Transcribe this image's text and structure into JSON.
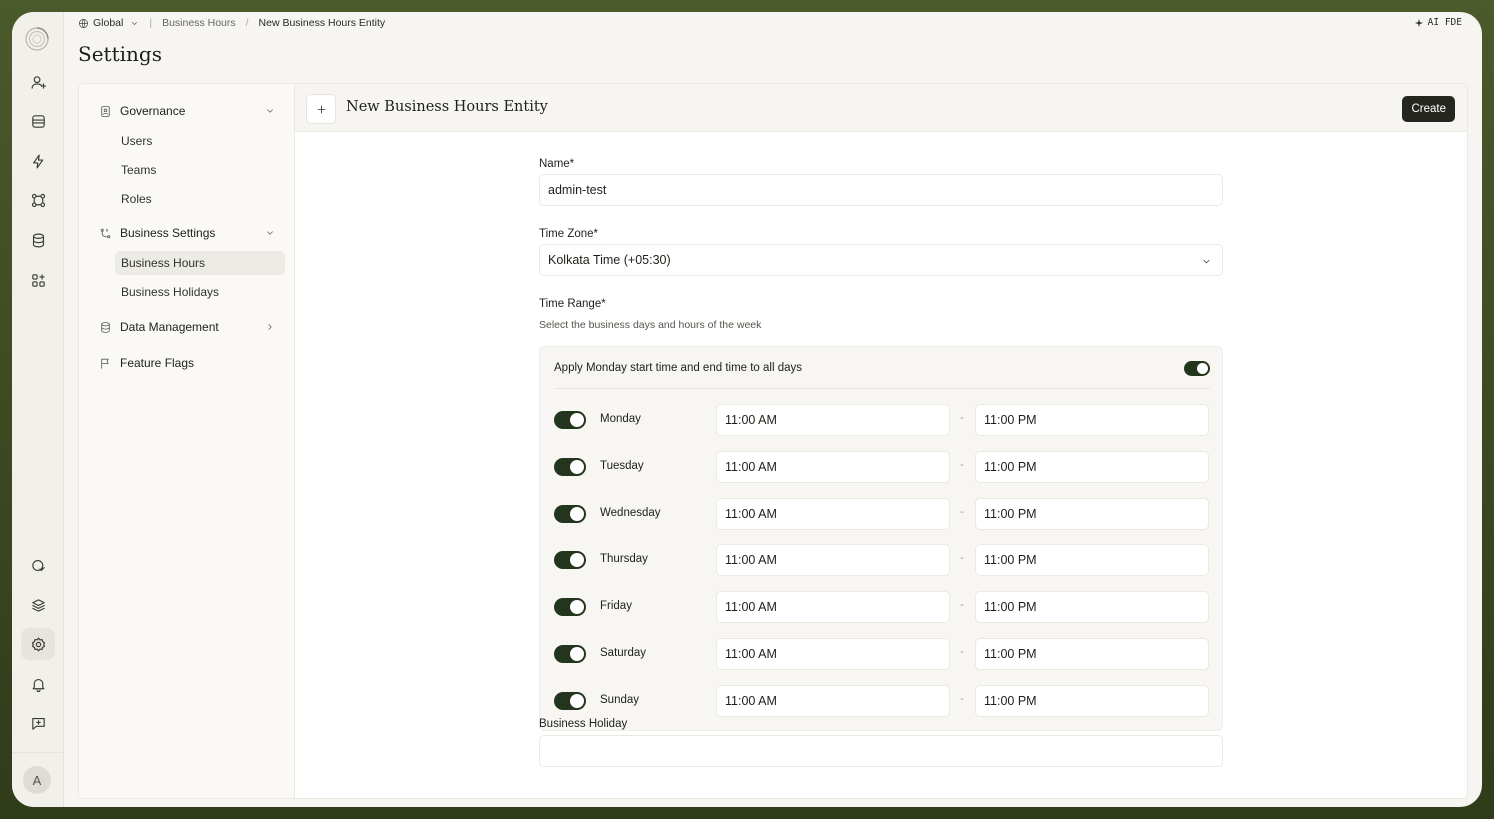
{
  "breadcrumb": {
    "scope": "Global",
    "parent": "Business Hours",
    "current": "New Business Hours Entity"
  },
  "topbar": {
    "ai_label": "AI FDE"
  },
  "page_title": "Settings",
  "rail": {
    "icons": [
      "user-plus-icon",
      "inbox-icon",
      "lightning-icon",
      "workflow-icon",
      "database-icon",
      "apps-add-icon",
      "shield-check-icon",
      "layers-icon",
      "settings-icon",
      "bell-icon",
      "chat-add-icon"
    ],
    "active": "settings-icon",
    "avatar_initial": "A"
  },
  "sidenav": {
    "governance": {
      "label": "Governance",
      "items": [
        "Users",
        "Teams",
        "Roles"
      ]
    },
    "business_settings": {
      "label": "Business Settings",
      "items": [
        "Business Hours",
        "Business Holidays"
      ],
      "active": "Business Hours"
    },
    "data_management": {
      "label": "Data Management"
    },
    "feature_flags": {
      "label": "Feature Flags"
    }
  },
  "content": {
    "title": "New Business Hours Entity",
    "create_label": "Create"
  },
  "form": {
    "name_label": "Name*",
    "name_value": "admin-test",
    "timezone_label": "Time Zone*",
    "timezone_value": "Kolkata Time (+05:30)",
    "time_range_label": "Time Range*",
    "time_range_hint": "Select the business days and hours of the week",
    "apply_all_label": "Apply Monday start time and end time to all days",
    "apply_all_enabled": true,
    "days": [
      {
        "name": "Monday",
        "enabled": true,
        "start": "11:00 AM",
        "end": "11:00 PM"
      },
      {
        "name": "Tuesday",
        "enabled": true,
        "start": "11:00 AM",
        "end": "11:00 PM"
      },
      {
        "name": "Wednesday",
        "enabled": true,
        "start": "11:00 AM",
        "end": "11:00 PM"
      },
      {
        "name": "Thursday",
        "enabled": true,
        "start": "11:00 AM",
        "end": "11:00 PM"
      },
      {
        "name": "Friday",
        "enabled": true,
        "start": "11:00 AM",
        "end": "11:00 PM"
      },
      {
        "name": "Saturday",
        "enabled": true,
        "start": "11:00 AM",
        "end": "11:00 PM"
      },
      {
        "name": "Sunday",
        "enabled": true,
        "start": "11:00 AM",
        "end": "11:00 PM"
      }
    ],
    "range_separator": "-",
    "holiday_label": "Business Holiday"
  },
  "colors": {
    "accent": "#23351c",
    "frame": "#3c4a22",
    "button": "#262621"
  }
}
